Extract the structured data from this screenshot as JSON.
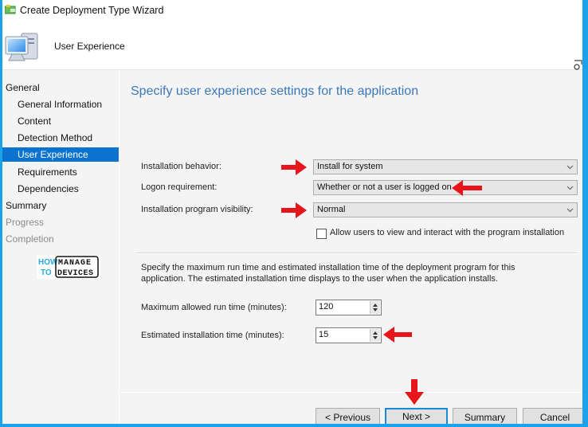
{
  "window": {
    "title": "Create Deployment Type Wizard",
    "page_name": "User Experience"
  },
  "nav": {
    "items": [
      {
        "label": "General",
        "level": "top",
        "state": "normal"
      },
      {
        "label": "General Information",
        "level": "child",
        "state": "normal"
      },
      {
        "label": "Content",
        "level": "child",
        "state": "normal"
      },
      {
        "label": "Detection Method",
        "level": "child",
        "state": "normal"
      },
      {
        "label": "User Experience",
        "level": "child",
        "state": "active"
      },
      {
        "label": "Requirements",
        "level": "child",
        "state": "normal"
      },
      {
        "label": "Dependencies",
        "level": "child",
        "state": "normal"
      },
      {
        "label": "Summary",
        "level": "top",
        "state": "normal"
      },
      {
        "label": "Progress",
        "level": "top",
        "state": "disabled"
      },
      {
        "label": "Completion",
        "level": "top",
        "state": "disabled"
      }
    ]
  },
  "logo": {
    "line1a": "HOW",
    "line1b": "MANAGE",
    "line2a": "TO",
    "line2b": "DEVICES"
  },
  "content": {
    "heading": "Specify user experience settings for the application",
    "installation_behavior": {
      "label": "Installation behavior:",
      "value": "Install for system"
    },
    "logon_requirement": {
      "label": "Logon requirement:",
      "value": "Whether or not a user is logged on"
    },
    "program_visibility": {
      "label": "Installation program visibility:",
      "value": "Normal"
    },
    "allow_interact": {
      "label": "Allow users to view and interact with the program installation",
      "checked": false
    },
    "description": "Specify the maximum run time and estimated installation time of the deployment program for this application. The estimated installation time displays to the user when the application installs.",
    "max_run_time": {
      "label": "Maximum allowed run time (minutes):",
      "value": "120"
    },
    "est_install_time": {
      "label": "Estimated installation time (minutes):",
      "value": "15"
    }
  },
  "buttons": {
    "previous": "< Previous",
    "next": "Next >",
    "summary": "Summary",
    "cancel": "Cancel"
  },
  "colors": {
    "accent": "#0a73cf",
    "heading": "#3a78b8",
    "frame": "#1aa3e8",
    "annotation_arrow": "#e8141b"
  }
}
